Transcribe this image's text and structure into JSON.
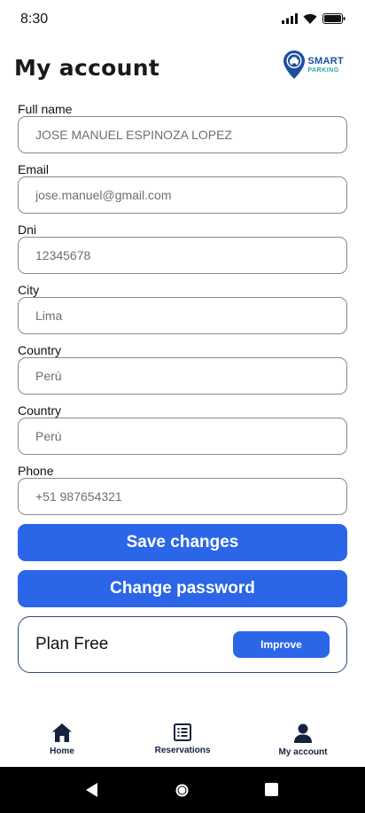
{
  "status_bar": {
    "time": "8:30",
    "icons": [
      "signal-icon",
      "wifi-icon",
      "battery-icon"
    ]
  },
  "header": {
    "title": "My account",
    "logo": {
      "line1": "SMART",
      "line2": "PARKING",
      "icon": "parking-location-pin-icon"
    }
  },
  "form": {
    "fields": [
      {
        "label": "Full name",
        "placeholder": "JOSE MANUEL ESPINOZA LOPEZ"
      },
      {
        "label": "Email",
        "placeholder": "jose.manuel@gmail.com"
      },
      {
        "label": "Dni",
        "placeholder": "12345678"
      },
      {
        "label": "City",
        "placeholder": "Lima"
      },
      {
        "label": "Country",
        "placeholder": "Perú"
      },
      {
        "label": "Country",
        "placeholder": "Perú"
      },
      {
        "label": "Phone",
        "placeholder": "+51 987654321"
      }
    ]
  },
  "actions": {
    "save_label": "Save changes",
    "change_password_label": "Change password"
  },
  "plan": {
    "label": "Plan Free",
    "improve_label": "Improve"
  },
  "bottom_nav": {
    "items": [
      {
        "label": "Home",
        "icon": "home-icon"
      },
      {
        "label": "Reservations",
        "icon": "list-icon"
      },
      {
        "label": "My account",
        "icon": "person-icon"
      }
    ]
  },
  "system_nav": [
    "back-icon",
    "home-circle-icon",
    "recents-icon"
  ],
  "colors": {
    "accent": "#2b66e8",
    "nav_text": "#16223d",
    "card_border": "#2e4a7d",
    "logo_blue": "#1d4fa0",
    "logo_teal": "#2aa7a0"
  }
}
